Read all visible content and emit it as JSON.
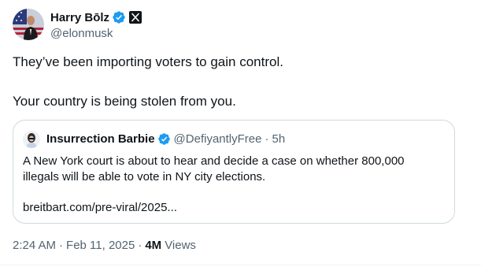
{
  "author": {
    "display_name": "Harry Bōlz",
    "handle": "@elonmusk",
    "verified_icon": "verified-badge-icon",
    "affiliation_icon": "x-logo-icon"
  },
  "tweet": {
    "lines": [
      "They’ve been importing voters to gain control.",
      "Your country is being stolen from you."
    ]
  },
  "quote": {
    "display_name": "Insurrection Barbie",
    "handle": "@DefiyantlyFree",
    "separator": "·",
    "time": "5h",
    "lines": [
      "A New York court is about to hear and decide a case on whether 800,000",
      "illegals will be able to vote in NY city elections."
    ],
    "link": "breitbart.com/pre-viral/2025..."
  },
  "meta": {
    "time": "2:24 AM",
    "separator": "·",
    "date": "Feb 11, 2025",
    "views_count": "4M",
    "views_label": "Views"
  },
  "colors": {
    "text": "#0f1419",
    "secondary": "#536471",
    "verified_blue": "#1d9bf0",
    "border": "#cfd9de"
  }
}
